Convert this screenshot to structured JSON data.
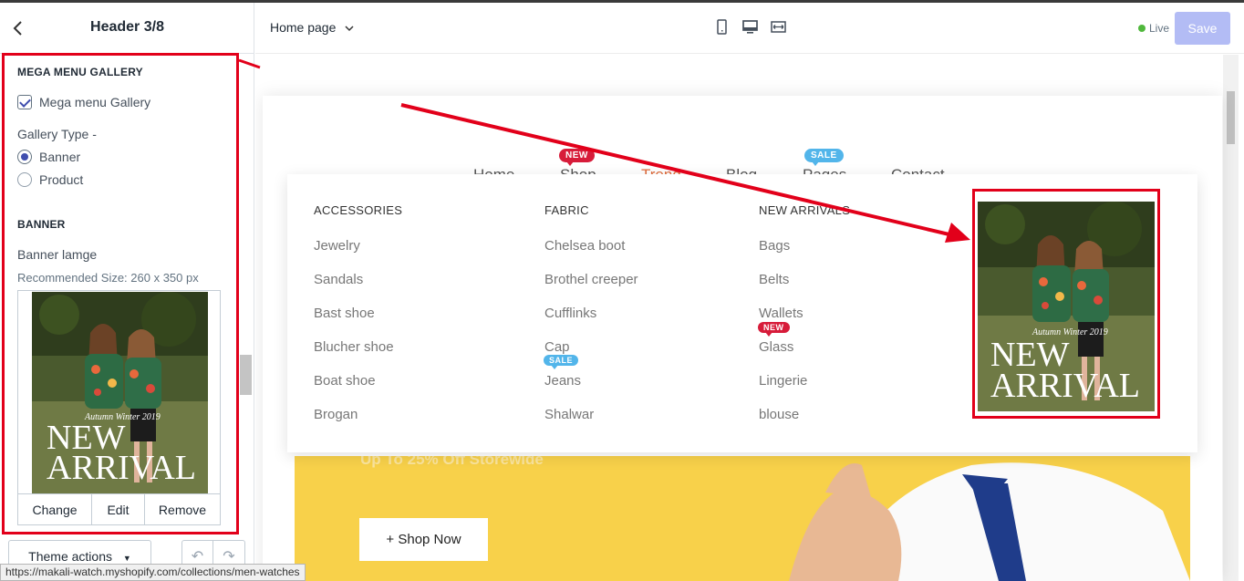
{
  "sidebar": {
    "back_icon": "chevron-left-icon",
    "title": "Header 3/8",
    "section_gallery": "MEGA MENU GALLERY",
    "checkbox_label": "Mega menu Gallery",
    "checkbox_checked": true,
    "gallery_type_label": "Gallery Type -",
    "gallery_options": [
      "Banner",
      "Product"
    ],
    "gallery_selected": "Banner",
    "section_banner": "BANNER",
    "banner_image_label": "Banner lamge",
    "recommended_size": "Recommended Size: 260 x 350 px",
    "image_actions": [
      "Change",
      "Edit",
      "Remove"
    ],
    "theme_actions": "Theme actions",
    "undo_icon": "undo-icon",
    "redo_icon": "redo-icon"
  },
  "banner_image": {
    "caption_small": "Autumn Winter 2019",
    "caption_line1": "NEW",
    "caption_line2": "ARRIVAL"
  },
  "topbar": {
    "page_select": "Home page",
    "device_icons": [
      "mobile-icon",
      "desktop-icon",
      "fullwidth-icon"
    ],
    "live_label": "Live",
    "save_label": "Save"
  },
  "status_url": "https://makali-watch.myshopify.com/collections/men-watches",
  "site": {
    "nav": [
      {
        "label": "Home",
        "has_caret": false,
        "badge": null
      },
      {
        "label": "Shop",
        "has_caret": true,
        "badge": "NEW"
      },
      {
        "label": "Trend",
        "has_caret": true,
        "badge": null
      },
      {
        "label": "Blog",
        "has_caret": true,
        "badge": null
      },
      {
        "label": "Pages",
        "has_caret": true,
        "badge": "SALE"
      },
      {
        "label": "Contact",
        "has_caret": false,
        "badge": null
      }
    ],
    "mega_menu": {
      "columns": [
        {
          "heading": "ACCESSORIES",
          "items": [
            "Jewelry",
            "Sandals",
            "Bast shoe",
            "Blucher shoe",
            "Boat shoe",
            "Brogan"
          ]
        },
        {
          "heading": "FABRIC",
          "items": [
            "Chelsea boot",
            "Brothel creeper",
            "Cufflinks",
            "Cap",
            "Jeans",
            "Shalwar"
          ]
        },
        {
          "heading": "NEW ARRIVALS",
          "items": [
            "Bags",
            "Belts",
            "Wallets",
            "Glass",
            "Lingerie",
            "blouse"
          ]
        }
      ],
      "item_badges": {
        "Jeans": "SALE",
        "Glass": "NEW"
      }
    },
    "hero": {
      "tagline": "Up To 25% Off Storewide",
      "button": "+ Shop Now"
    }
  },
  "colors": {
    "accent_red": "#e2001a",
    "save_button": "#b3bcf5",
    "hero_yellow": "#f8d14a",
    "nav_active": "#e06c3c",
    "badge_new": "#d71c3a",
    "badge_sale": "#52b5ea",
    "live_green": "#50b83c"
  }
}
